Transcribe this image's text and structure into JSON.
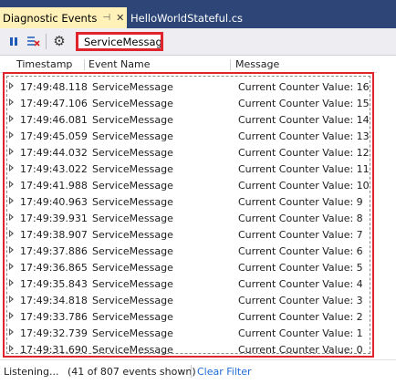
{
  "tabs": {
    "active_label": "Diagnostic Events",
    "inactive_label": "HelloWorldStateful.cs",
    "pin_icon": "pin-icon",
    "close_icon": "close-icon"
  },
  "toolbar": {
    "pause_icon": "pause-icon",
    "clear_icon": "clear-events-icon",
    "settings_icon": "gear-icon",
    "filter_value": "ServiceMessage"
  },
  "columns": {
    "timestamp": "Timestamp",
    "event_name": "Event Name",
    "message": "Message"
  },
  "events": [
    {
      "time": "17:49:48.118",
      "name": "ServiceMessage",
      "message": "Current Counter Value: 16"
    },
    {
      "time": "17:49:47.106",
      "name": "ServiceMessage",
      "message": "Current Counter Value: 15"
    },
    {
      "time": "17:49:46.081",
      "name": "ServiceMessage",
      "message": "Current Counter Value: 14"
    },
    {
      "time": "17:49:45.059",
      "name": "ServiceMessage",
      "message": "Current Counter Value: 13"
    },
    {
      "time": "17:49:44.032",
      "name": "ServiceMessage",
      "message": "Current Counter Value: 12"
    },
    {
      "time": "17:49:43.022",
      "name": "ServiceMessage",
      "message": "Current Counter Value: 11"
    },
    {
      "time": "17:49:41.988",
      "name": "ServiceMessage",
      "message": "Current Counter Value: 10"
    },
    {
      "time": "17:49:40.963",
      "name": "ServiceMessage",
      "message": "Current Counter Value: 9"
    },
    {
      "time": "17:49:39.931",
      "name": "ServiceMessage",
      "message": "Current Counter Value: 8"
    },
    {
      "time": "17:49:38.907",
      "name": "ServiceMessage",
      "message": "Current Counter Value: 7"
    },
    {
      "time": "17:49:37.886",
      "name": "ServiceMessage",
      "message": "Current Counter Value: 6"
    },
    {
      "time": "17:49:36.865",
      "name": "ServiceMessage",
      "message": "Current Counter Value: 5"
    },
    {
      "time": "17:49:35.843",
      "name": "ServiceMessage",
      "message": "Current Counter Value: 4"
    },
    {
      "time": "17:49:34.818",
      "name": "ServiceMessage",
      "message": "Current Counter Value: 3"
    },
    {
      "time": "17:49:33.786",
      "name": "ServiceMessage",
      "message": "Current Counter Value: 2"
    },
    {
      "time": "17:49:32.739",
      "name": "ServiceMessage",
      "message": "Current Counter Value: 1"
    },
    {
      "time": "17:49:31.690",
      "name": "ServiceMessage",
      "message": "Current Counter Value: 0"
    }
  ],
  "status": {
    "listening": "Listening...",
    "count": "(41 of 807 events shown)",
    "clear_filter": "Clear Filter"
  },
  "colors": {
    "tab_bar": "#2d4677",
    "active_tab": "#fff1b7",
    "highlight": "#e0242c",
    "link": "#1e6bd6"
  }
}
